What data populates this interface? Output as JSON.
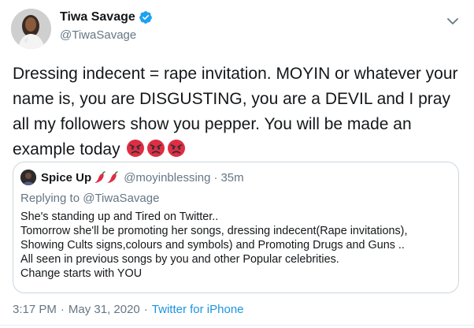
{
  "author": {
    "display_name": "Tiwa Savage",
    "handle": "@TiwaSavage",
    "verified": true,
    "avatar_icon": "profile-photo"
  },
  "tweet": {
    "text": "Dressing indecent = rape invitation. MOYIN or whatever your name is, you are DISGUSTING, you are a DEVIL and I pray all my followers show you pepper. You will be made an example today",
    "emojis": [
      "angry-face-emoji",
      "angry-face-emoji",
      "angry-face-emoji"
    ]
  },
  "quote": {
    "display_name": "Spice Up",
    "name_emojis": [
      "chili-pepper-emoji",
      "chili-pepper-emoji"
    ],
    "handle": "@moyinblessing",
    "dot": "·",
    "time": "35m",
    "replying_prefix": "Replying to",
    "replying_to": "@TiwaSavage",
    "lines": [
      "She's standing up and Tired on Twitter..",
      "Tomorrow she'll be promoting her songs, dressing indecent(Rape invitations),",
      "Showing Cults signs,colours and symbols) and Promoting Drugs and Guns ..",
      "All seen in previous songs by you and other Popular celebrities.",
      "Change starts with YOU"
    ]
  },
  "meta": {
    "time": "3:17 PM",
    "sep": "·",
    "date": "May 31, 2020",
    "source": "Twitter for iPhone"
  },
  "colors": {
    "text": "#14171a",
    "secondary": "#657786",
    "link": "#1b95e0",
    "border": "#ccd6dd",
    "verified": "#1da1f2"
  }
}
